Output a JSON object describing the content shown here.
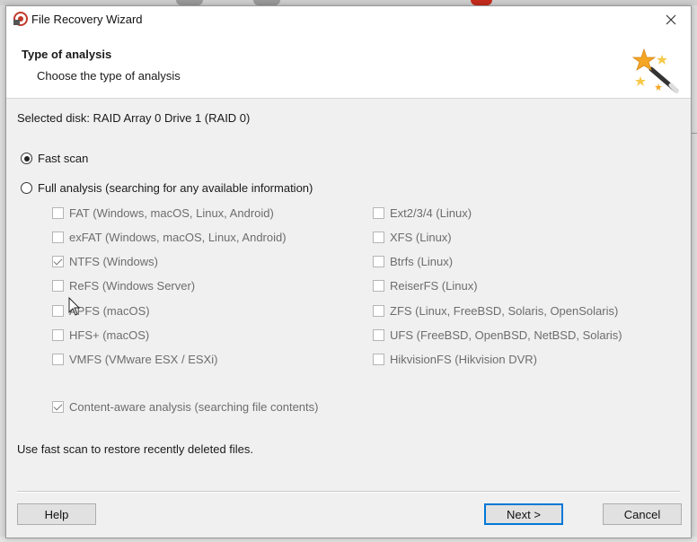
{
  "window": {
    "title": "File Recovery Wizard",
    "close_glyph": "✕",
    "icon": "app-icon"
  },
  "header": {
    "title": "Type of analysis",
    "subtitle": "Choose the type of analysis",
    "icon": "magic-wand-icon"
  },
  "selected_disk": "Selected disk: RAID Array 0 Drive 1 (RAID 0)",
  "scan_options": {
    "fast_scan": {
      "label": "Fast scan",
      "selected": true
    },
    "full_analysis": {
      "label": "Full analysis (searching for any available information)",
      "selected": false
    }
  },
  "filesystems": {
    "left": [
      {
        "label": "FAT (Windows, macOS, Linux, Android)",
        "checked": false
      },
      {
        "label": "exFAT (Windows, macOS, Linux, Android)",
        "checked": false
      },
      {
        "label": "NTFS (Windows)",
        "checked": true
      },
      {
        "label": "ReFS (Windows Server)",
        "checked": false
      },
      {
        "label": "APFS (macOS)",
        "checked": false
      },
      {
        "label": "HFS+ (macOS)",
        "checked": false
      },
      {
        "label": "VMFS (VMware ESX / ESXi)",
        "checked": false
      }
    ],
    "right": [
      {
        "label": "Ext2/3/4 (Linux)",
        "checked": false
      },
      {
        "label": "XFS (Linux)",
        "checked": false
      },
      {
        "label": "Btrfs (Linux)",
        "checked": false
      },
      {
        "label": "ReiserFS (Linux)",
        "checked": false
      },
      {
        "label": "ZFS (Linux, FreeBSD, Solaris, OpenSolaris)",
        "checked": false
      },
      {
        "label": "UFS (FreeBSD, OpenBSD, NetBSD, Solaris)",
        "checked": false
      },
      {
        "label": "HikvisionFS (Hikvision DVR)",
        "checked": false
      }
    ]
  },
  "content_aware": {
    "label": "Content-aware analysis (searching file contents)",
    "checked": true
  },
  "hint": "Use fast scan to restore recently deleted files.",
  "buttons": {
    "help": "Help",
    "next": "Next >",
    "cancel": "Cancel"
  },
  "colors": {
    "accent": "#0078d7",
    "dialog_bg": "#f0f0f0",
    "header_bg": "#ffffff",
    "disabled_text": "#6d6d6d"
  }
}
